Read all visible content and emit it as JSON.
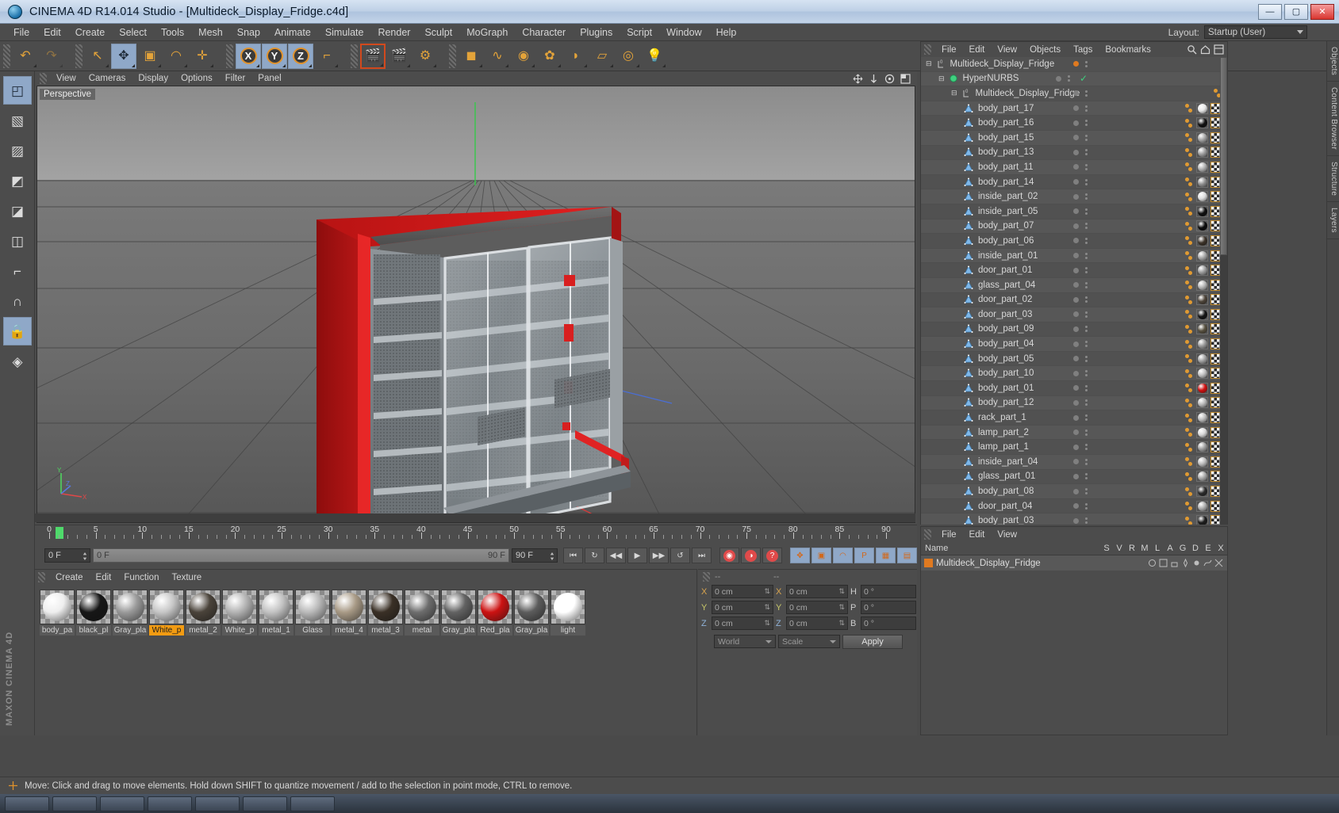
{
  "window": {
    "title": "CINEMA 4D R14.014 Studio - [Multideck_Display_Fridge.c4d]",
    "minimize": "—",
    "maximize": "▢",
    "close": "✕"
  },
  "menubar": {
    "items": [
      "File",
      "Edit",
      "Create",
      "Select",
      "Tools",
      "Mesh",
      "Snap",
      "Animate",
      "Simulate",
      "Render",
      "Sculpt",
      "MoGraph",
      "Character",
      "Plugins",
      "Script",
      "Window",
      "Help"
    ],
    "layout_label": "Layout:",
    "layout_value": "Startup (User)"
  },
  "toolbar": {
    "groups": [
      {
        "buttons": [
          {
            "name": "undo-icon",
            "glyph": "↶",
            "state": "normal"
          },
          {
            "name": "redo-icon",
            "glyph": "↷",
            "state": "disabled"
          }
        ]
      },
      {
        "buttons": [
          {
            "name": "live-selection-icon",
            "glyph": "↖",
            "state": "normal"
          },
          {
            "name": "move-tool-icon",
            "glyph": "✥",
            "state": "selected"
          },
          {
            "name": "scale-tool-icon",
            "glyph": "▣",
            "state": "normal"
          },
          {
            "name": "rotate-tool-icon",
            "glyph": "◠",
            "state": "normal"
          },
          {
            "name": "plus-tool-icon",
            "glyph": "✛",
            "state": "normal"
          }
        ]
      },
      {
        "buttons": [
          {
            "name": "lock-x-axis-icon",
            "glyph": "X",
            "state": "selected"
          },
          {
            "name": "lock-y-axis-icon",
            "glyph": "Y",
            "state": "selected"
          },
          {
            "name": "lock-z-axis-icon",
            "glyph": "Z",
            "state": "selected"
          },
          {
            "name": "world-object-axis-icon",
            "glyph": "⌐",
            "state": "normal"
          }
        ]
      },
      {
        "buttons": [
          {
            "name": "render-view-icon",
            "glyph": "🎬",
            "state": "active"
          },
          {
            "name": "render-region-icon",
            "glyph": "🎬",
            "state": "normal"
          },
          {
            "name": "render-settings-icon",
            "glyph": "⚙",
            "state": "normal"
          }
        ]
      },
      {
        "buttons": [
          {
            "name": "cube-primitive-icon",
            "glyph": "◼",
            "state": "normal"
          },
          {
            "name": "spline-pen-icon",
            "glyph": "∿",
            "state": "normal"
          },
          {
            "name": "nurbs-icon",
            "glyph": "◉",
            "state": "normal"
          },
          {
            "name": "array-icon",
            "glyph": "✿",
            "state": "normal"
          },
          {
            "name": "bend-deformer-icon",
            "glyph": "◗",
            "state": "normal"
          },
          {
            "name": "floor-environment-icon",
            "glyph": "▱",
            "state": "normal"
          },
          {
            "name": "camera-icon",
            "glyph": "◎",
            "state": "normal"
          },
          {
            "name": "light-icon",
            "glyph": "💡",
            "state": "normal"
          }
        ]
      }
    ]
  },
  "left_tools": [
    {
      "name": "model-mode-icon",
      "glyph": "◰",
      "state": "selected"
    },
    {
      "name": "texture-mode-icon",
      "glyph": "▧",
      "state": "normal"
    },
    {
      "name": "points-mode-icon",
      "glyph": "▨",
      "state": "normal"
    },
    {
      "name": "edges-mode-icon",
      "glyph": "◩",
      "state": "normal"
    },
    {
      "name": "polygons-mode-icon",
      "glyph": "◪",
      "state": "normal"
    },
    {
      "name": "object-axis-mode-icon",
      "glyph": "◫",
      "state": "normal"
    },
    {
      "name": "workplane-icon",
      "glyph": "⌐",
      "state": "normal"
    },
    {
      "name": "magnet-icon",
      "glyph": "∩",
      "state": "normal"
    },
    {
      "name": "lock-axis-icon",
      "glyph": "🔒",
      "state": "selected"
    },
    {
      "name": "enable-snapping-icon",
      "glyph": "◈",
      "state": "normal"
    }
  ],
  "maxon_logo": "MAXON CINEMA 4D",
  "viewport": {
    "menu": [
      "View",
      "Cameras",
      "Display",
      "Options",
      "Filter",
      "Panel"
    ],
    "label": "Perspective",
    "icons": [
      "pan-icon",
      "zoom-icon",
      "rotate-icon",
      "maximize-viewport-icon"
    ],
    "axis": {
      "x": "X",
      "y": "Y",
      "z": "Z"
    }
  },
  "timeline": {
    "ruler_labels": [
      "0",
      "5",
      "10",
      "15",
      "20",
      "25",
      "30",
      "35",
      "40",
      "45",
      "50",
      "55",
      "60",
      "65",
      "70",
      "75",
      "80",
      "85",
      "90"
    ],
    "ruler_min": 0,
    "ruler_max": 90,
    "current_frame": "0 F",
    "scrub_start": "0 F",
    "scrub_end": "90 F",
    "end_frame": "90 F",
    "buttons": [
      {
        "name": "go-to-start-button",
        "glyph": "⏮"
      },
      {
        "name": "loop-button",
        "glyph": "↻"
      },
      {
        "name": "step-back-button",
        "glyph": "◀◀"
      },
      {
        "name": "play-button",
        "glyph": "▶"
      },
      {
        "name": "step-forward-button",
        "glyph": "▶▶"
      },
      {
        "name": "loop-forward-button",
        "glyph": "↺"
      },
      {
        "name": "go-to-end-button",
        "glyph": "⏭"
      },
      {
        "name": "record-active-objects-button",
        "glyph": "◉"
      },
      {
        "name": "autokeying-button",
        "glyph": "◑"
      },
      {
        "name": "keyframe-selection-button",
        "glyph": "?"
      },
      {
        "name": "position-key-button",
        "glyph": "✥"
      },
      {
        "name": "scale-key-button",
        "glyph": "▣"
      },
      {
        "name": "rotation-key-button",
        "glyph": "◠"
      },
      {
        "name": "parameter-key-button",
        "glyph": "P"
      },
      {
        "name": "pla-key-button",
        "glyph": "▦"
      },
      {
        "name": "animation-layout-button",
        "glyph": "▤"
      }
    ]
  },
  "material_manager": {
    "menu": [
      "Create",
      "Edit",
      "Function",
      "Texture"
    ],
    "materials": [
      {
        "label": "body_pa",
        "color": "#eeeeee",
        "selected": false
      },
      {
        "label": "black_pl",
        "color": "#161616",
        "selected": false
      },
      {
        "label": "Gray_pla",
        "color": "#9a9a9a",
        "selected": false
      },
      {
        "label": "White_p",
        "color": "#c6c6c6",
        "selected": true
      },
      {
        "label": "metal_2",
        "color": "#4a433a",
        "selected": false
      },
      {
        "label": "White_p",
        "color": "#b3b3b3",
        "selected": false
      },
      {
        "label": "metal_1",
        "color": "#c2c2c2",
        "selected": false
      },
      {
        "label": "Glass",
        "color": "#b9b9b9",
        "selected": false
      },
      {
        "label": "metal_4",
        "color": "#a89a86",
        "selected": false
      },
      {
        "label": "metal_3",
        "color": "#3a3026",
        "selected": false
      },
      {
        "label": "metal",
        "color": "#6d6d6d",
        "selected": false
      },
      {
        "label": "Gray_pla",
        "color": "#626262",
        "selected": false
      },
      {
        "label": "Red_pla",
        "color": "#cc1212",
        "selected": false
      },
      {
        "label": "Gray_pla",
        "color": "#5c5c5c",
        "selected": false
      },
      {
        "label": "light",
        "color": "#ffffff",
        "selected": false
      }
    ]
  },
  "coordinates": {
    "header_left": "--",
    "header_right": "--",
    "rows": [
      {
        "axis": "X",
        "position": "0 cm",
        "size": "0 cm",
        "rot_label": "H",
        "rotation": "0 °"
      },
      {
        "axis": "Y",
        "position": "0 cm",
        "size": "0 cm",
        "rot_label": "P",
        "rotation": "0 °"
      },
      {
        "axis": "Z",
        "position": "0 cm",
        "size": "0 cm",
        "rot_label": "B",
        "rotation": "0 °"
      }
    ],
    "coord_system": "World",
    "size_mode": "Scale",
    "apply_label": "Apply"
  },
  "object_manager": {
    "menu": [
      "File",
      "Edit",
      "View",
      "Objects",
      "Tags",
      "Bookmarks"
    ],
    "header_icons": [
      "search-icon",
      "home-icon",
      "layout-icon"
    ],
    "rows": [
      {
        "label": "Multideck_Display_Fridge",
        "depth": 0,
        "icon": "null-object-icon",
        "expandable": true,
        "dot_color": "#e07a20",
        "has_tags": false,
        "check": false
      },
      {
        "label": "HyperNURBS",
        "depth": 1,
        "icon": "hypernurbs-icon",
        "expandable": true,
        "dot_color": "#7f7f7f",
        "has_tags": false,
        "check": true
      },
      {
        "label": "Multideck_Display_Fridge",
        "depth": 2,
        "icon": "null-object-icon",
        "expandable": true,
        "dot_color": "#7f7f7f",
        "has_tags": false,
        "check": false
      },
      {
        "label": "body_part_17",
        "depth": 3,
        "icon": "polygon-object-icon",
        "mat": "#e8e8e8",
        "has_tags": true
      },
      {
        "label": "body_part_16",
        "depth": 3,
        "icon": "polygon-object-icon",
        "mat": "#111111",
        "has_tags": true
      },
      {
        "label": "body_part_15",
        "depth": 3,
        "icon": "polygon-object-icon",
        "mat": "#a5a5a5",
        "has_tags": true
      },
      {
        "label": "body_part_13",
        "depth": 3,
        "icon": "polygon-object-icon",
        "mat": "#9d9d9d",
        "has_tags": true
      },
      {
        "label": "body_part_11",
        "depth": 3,
        "icon": "polygon-object-icon",
        "mat": "#b0b0b0",
        "has_tags": true
      },
      {
        "label": "body_part_14",
        "depth": 3,
        "icon": "polygon-object-icon",
        "mat": "#8f8f8f",
        "has_tags": true
      },
      {
        "label": "inside_part_02",
        "depth": 3,
        "icon": "polygon-object-icon",
        "mat": "#dedede",
        "has_tags": true
      },
      {
        "label": "inside_part_05",
        "depth": 3,
        "icon": "polygon-object-icon",
        "mat": "#0e0e0e",
        "has_tags": true
      },
      {
        "label": "body_part_07",
        "depth": 3,
        "icon": "polygon-object-icon",
        "mat": "#0c0c0c",
        "has_tags": true
      },
      {
        "label": "body_part_06",
        "depth": 3,
        "icon": "polygon-object-icon",
        "mat": "#3b3228",
        "has_tags": true
      },
      {
        "label": "inside_part_01",
        "depth": 3,
        "icon": "polygon-object-icon",
        "mat": "#a8a8a8",
        "has_tags": true
      },
      {
        "label": "door_part_01",
        "depth": 3,
        "icon": "polygon-object-icon",
        "mat": "#9e9e9e",
        "has_tags": true
      },
      {
        "label": "glass_part_04",
        "depth": 3,
        "icon": "polygon-object-icon",
        "mat": "#b6b6b6",
        "has_tags": true
      },
      {
        "label": "door_part_02",
        "depth": 3,
        "icon": "polygon-object-icon",
        "mat": "#4c4338",
        "has_tags": true
      },
      {
        "label": "door_part_03",
        "depth": 3,
        "icon": "polygon-object-icon",
        "mat": "#141414",
        "has_tags": true
      },
      {
        "label": "body_part_09",
        "depth": 3,
        "icon": "polygon-object-icon",
        "mat": "#57503f",
        "has_tags": true
      },
      {
        "label": "body_part_04",
        "depth": 3,
        "icon": "polygon-object-icon",
        "mat": "#9b9b9b",
        "has_tags": true
      },
      {
        "label": "body_part_05",
        "depth": 3,
        "icon": "polygon-object-icon",
        "mat": "#a2a2a2",
        "has_tags": true
      },
      {
        "label": "body_part_10",
        "depth": 3,
        "icon": "polygon-object-icon",
        "mat": "#c0c0c0",
        "has_tags": true
      },
      {
        "label": "body_part_01",
        "depth": 3,
        "icon": "polygon-object-icon",
        "mat": "#d01010",
        "has_tags": true
      },
      {
        "label": "body_part_12",
        "depth": 3,
        "icon": "polygon-object-icon",
        "mat": "#b8b8b8",
        "has_tags": true
      },
      {
        "label": "rack_part_1",
        "depth": 3,
        "icon": "polygon-object-icon",
        "mat": "#bdbdbd",
        "has_tags": true
      },
      {
        "label": "lamp_part_2",
        "depth": 3,
        "icon": "polygon-object-icon",
        "mat": "#d8d8d8",
        "has_tags": true
      },
      {
        "label": "lamp_part_1",
        "depth": 3,
        "icon": "polygon-object-icon",
        "mat": "#9f9f9f",
        "has_tags": true
      },
      {
        "label": "inside_part_04",
        "depth": 3,
        "icon": "polygon-object-icon",
        "mat": "#bcbcbc",
        "has_tags": true
      },
      {
        "label": "glass_part_01",
        "depth": 3,
        "icon": "polygon-object-icon",
        "mat": "#a9a9a9",
        "has_tags": true
      },
      {
        "label": "body_part_08",
        "depth": 3,
        "icon": "polygon-object-icon",
        "mat": "#2a2a2a",
        "has_tags": true
      },
      {
        "label": "door_part_04",
        "depth": 3,
        "icon": "polygon-object-icon",
        "mat": "#aeaeae",
        "has_tags": true
      },
      {
        "label": "body_part_03",
        "depth": 3,
        "icon": "polygon-object-icon",
        "mat": "#1c1c1c",
        "has_tags": true
      }
    ]
  },
  "attribute_manager": {
    "menu": [
      "File",
      "Edit",
      "View"
    ],
    "columns": [
      "Name",
      "S",
      "V",
      "R",
      "M",
      "L",
      "A",
      "G",
      "D",
      "E",
      "X"
    ],
    "row": {
      "label": "Multideck_Display_Fridge",
      "swatch_color": "#e07a20"
    }
  },
  "right_dock_tabs": [
    "Objects",
    "Content Browser",
    "Structure",
    "Layers"
  ],
  "statusbar": {
    "message": "Move: Click and drag to move elements. Hold down SHIFT to quantize movement / add to the selection in point mode, CTRL to remove."
  }
}
